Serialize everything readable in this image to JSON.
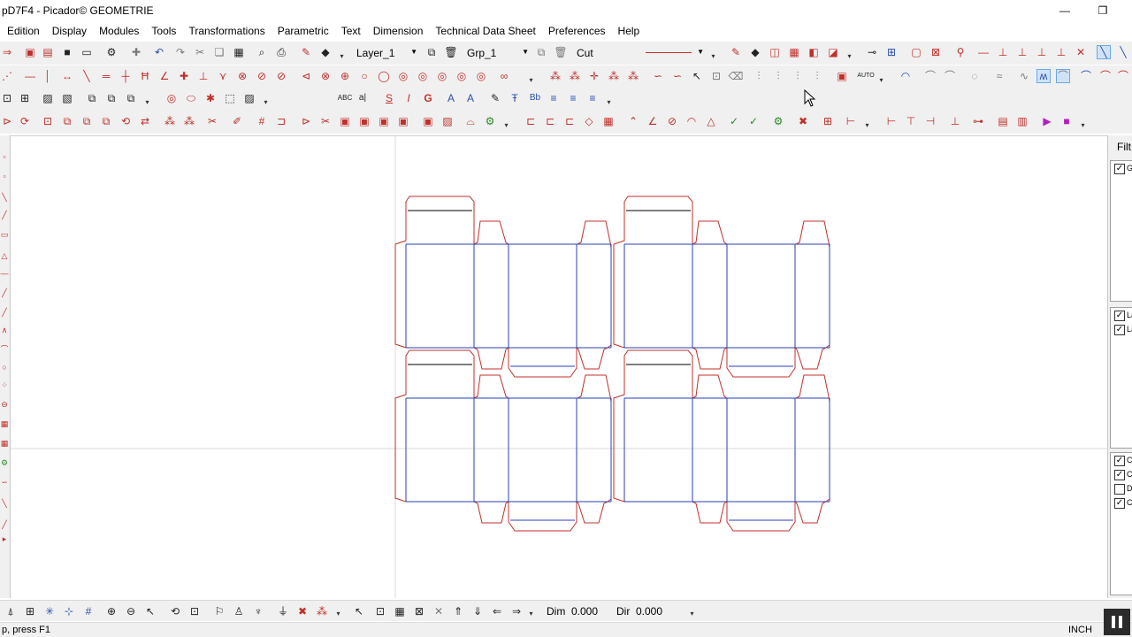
{
  "window": {
    "title": "pD7F4 - Picador© GEOMETRIE",
    "minimize_glyph": "—",
    "restore_glyph": "❐"
  },
  "menu": [
    "Edition",
    "Display",
    "Modules",
    "Tools",
    "Transformations",
    "Parametric",
    "Text",
    "Dimension",
    "Technical Data Sheet",
    "Preferences",
    "Help"
  ],
  "toolbar": {
    "layer": "Layer_1",
    "group": "Grp_1",
    "line_type": "Cut",
    "auto_label": "AUTO",
    "text_buttons": [
      "ABC",
      "a|",
      "S",
      "I",
      "G",
      "Bb"
    ]
  },
  "right_panel": {
    "filter_label": "Filt",
    "group_items": [
      {
        "label": "Gr",
        "checked": true
      }
    ],
    "layer_items": [
      {
        "label": "La",
        "checked": true
      },
      {
        "label": "La",
        "checked": true
      }
    ],
    "type_items": [
      {
        "label": "Cu",
        "checked": true
      },
      {
        "label": "Cr",
        "checked": true
      },
      {
        "label": "Di",
        "checked": false
      },
      {
        "label": "Cu",
        "checked": true
      }
    ]
  },
  "bottom": {
    "dim_label": "Dim",
    "dim_value": "0.000",
    "dir_label": "Dir",
    "dir_value": "0.000"
  },
  "status": {
    "help": "p, press F1",
    "units": "INCH"
  },
  "colors": {
    "cut": "#c0302b",
    "crease": "#2a3fb5",
    "axis": "#d8d8d8"
  },
  "icons": {
    "row1": [
      "open-folder-icon",
      "new-file-icon",
      "save-icon",
      "print-preview-icon",
      "settings-icon",
      "add-icon",
      "undo-icon",
      "redo-icon",
      "cut-icon",
      "copy-icon",
      "paste-icon",
      "zoom-preview-icon",
      "printer-icon",
      "layer-edit-icon",
      "layer-lock-icon"
    ],
    "row2": [
      "line-icon",
      "hline-icon",
      "vline-icon",
      "dimension-icon",
      "diagonal-icon",
      "cross-icon",
      "perpendicular-icon",
      "angle-icon",
      "circle-icon",
      "arc-icon",
      "rect-icon",
      "polygon-icon"
    ],
    "row3": [
      "snap-icon",
      "grid-icon",
      "image-icon",
      "bitmap-icon",
      "ellipse-icon",
      "hatch-icon",
      "text-icon",
      "bold-icon",
      "italic-icon",
      "font-icon",
      "align-left-icon",
      "align-center-icon",
      "align-right-icon"
    ],
    "row4": [
      "mirror-icon",
      "rotate-icon",
      "scale-icon",
      "offset-icon",
      "array-icon",
      "trim-icon",
      "extend-icon",
      "fillet-icon",
      "chamfer-icon",
      "table-icon",
      "play-icon",
      "stop-icon"
    ]
  }
}
